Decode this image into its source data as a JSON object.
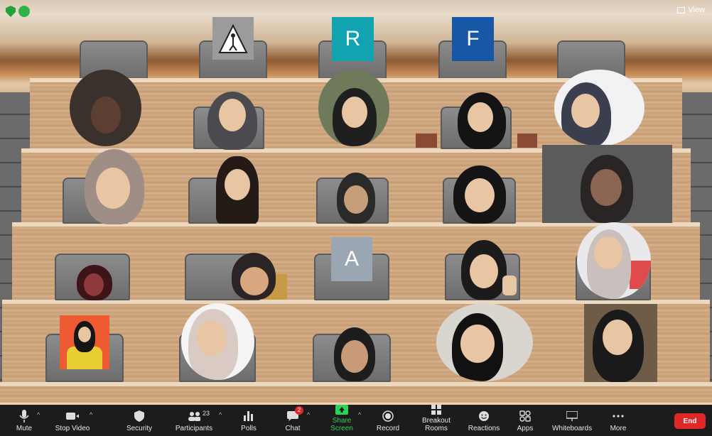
{
  "header": {
    "view_label": "View"
  },
  "tiles": {
    "r": "R",
    "f": "F",
    "a": "A"
  },
  "toolbar": {
    "mute": "Mute",
    "stop_video": "Stop Video",
    "security": "Security",
    "participants": "Participants",
    "participants_count": "23",
    "polls": "Polls",
    "chat": "Chat",
    "chat_badge": "2",
    "share_screen": "Share Screen",
    "record": "Record",
    "breakout_rooms": "Breakout Rooms",
    "reactions": "Reactions",
    "apps": "Apps",
    "whiteboards": "Whiteboards",
    "more": "More",
    "end": "End"
  },
  "colors": {
    "r_tile": "#12a3b0",
    "f_tile": "#1757a6",
    "a_tile": "#9aa7b3",
    "share_green": "#2bd358",
    "end_red": "#e02828",
    "recording_green": "#2fb24a"
  }
}
